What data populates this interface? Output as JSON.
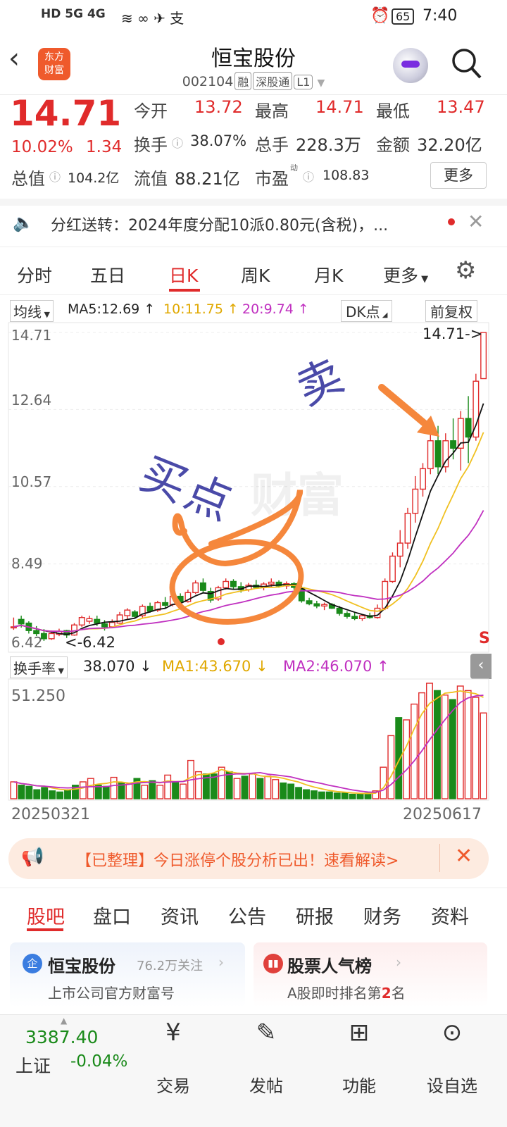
{
  "status_bar": {
    "left_icons": "HD 5G 4G",
    "battery": "65",
    "time": "7:40"
  },
  "header": {
    "title": "恒宝股份",
    "code": "002104",
    "tags": [
      "融",
      "深股通",
      "L1"
    ],
    "logo_text": [
      "东方",
      "财富"
    ]
  },
  "quote": {
    "price": "14.71",
    "change_pct": "10.02%",
    "change_abs": "1.34",
    "open_label": "今开",
    "open": "13.72",
    "high_label": "最高",
    "high": "14.71",
    "low_label": "最低",
    "low": "13.47",
    "turnover_label": "换手",
    "turnover": "38.07%",
    "vol_label": "总手",
    "vol": "228.3万",
    "amount_label": "金额",
    "amount": "32.20亿",
    "mcap_label": "总值",
    "mcap": "104.2亿",
    "float_label": "流值",
    "float": "88.21亿",
    "pe_label": "市盈",
    "pe_sup": "动",
    "pe": "108.83",
    "more_button": "更多"
  },
  "notice": {
    "text": "分红送转：2024年度分配10派0.80元(含税)，..."
  },
  "chart_tabs": [
    "分时",
    "五日",
    "日K",
    "周K",
    "月K",
    "更多"
  ],
  "ma_bar": {
    "selector": "均线",
    "ma5": "MA5:12.69 ↑",
    "ma10": "10:11.75 ↑",
    "ma20": "20:9.74 ↑",
    "dk": "DK点",
    "adjust": "前复权"
  },
  "price_axis": [
    "14.71",
    "12.64",
    "10.57",
    "8.49",
    "6.42"
  ],
  "annotations": {
    "last_price": "14.71->",
    "low_marker": "<-6.42",
    "s_marker": "S",
    "sell": "卖",
    "buy": "买点",
    "watermark": "财富"
  },
  "volume_bar": {
    "selector": "换手率",
    "value": "38.070 ↓",
    "ma1": "MA1:43.670 ↓",
    "ma2": "MA2:46.070 ↑",
    "max_label": "51.250"
  },
  "dates": {
    "start": "20250321",
    "end": "20250617"
  },
  "promo": {
    "text": "【已整理】今日涨停个股分析已出！速看解读>"
  },
  "bottom_tabs": [
    "股吧",
    "盘口",
    "资讯",
    "公告",
    "研报",
    "财务",
    "资料"
  ],
  "cards": {
    "left_title": "恒宝股份",
    "left_follow": "76.2万关注",
    "left_sub": "上市公司官方财富号",
    "right_title": "股票人气榜",
    "right_sub_pre": "A股即时排名第",
    "right_sub_num": "2",
    "right_sub_post": "名"
  },
  "index": {
    "value": "3387.40",
    "name": "上证",
    "change": "-0.04%"
  },
  "bottom_nav": [
    "交易",
    "发帖",
    "功能",
    "设自选"
  ],
  "colors": {
    "up": "#e02b2b",
    "down": "#1a8a1a",
    "orange": "#f5873c",
    "ma10": "#f0c020",
    "ma20": "#c030c0"
  },
  "chart_data": {
    "type": "candlestick",
    "ylim": [
      6.42,
      14.71
    ],
    "candles": [
      [
        6.8,
        7.05,
        6.72,
        6.8
      ],
      [
        7.0,
        7.1,
        6.78,
        6.88
      ],
      [
        6.9,
        6.95,
        6.62,
        6.7
      ],
      [
        6.7,
        6.82,
        6.55,
        6.62
      ],
      [
        6.62,
        6.74,
        6.42,
        6.48
      ],
      [
        6.48,
        6.7,
        6.45,
        6.62
      ],
      [
        6.6,
        6.75,
        6.55,
        6.68
      ],
      [
        6.7,
        6.72,
        6.5,
        6.58
      ],
      [
        6.58,
        6.9,
        6.56,
        6.85
      ],
      [
        6.85,
        7.1,
        6.8,
        7.05
      ],
      [
        6.95,
        7.1,
        6.88,
        7.02
      ],
      [
        7.0,
        7.1,
        6.82,
        6.9
      ],
      [
        6.88,
        6.98,
        6.7,
        6.8
      ],
      [
        6.8,
        7.0,
        6.76,
        6.92
      ],
      [
        6.9,
        7.2,
        6.88,
        7.12
      ],
      [
        7.1,
        7.3,
        7.0,
        7.25
      ],
      [
        7.2,
        7.25,
        7.02,
        7.08
      ],
      [
        7.1,
        7.4,
        7.05,
        7.35
      ],
      [
        7.35,
        7.45,
        7.18,
        7.22
      ],
      [
        7.25,
        7.5,
        7.2,
        7.45
      ],
      [
        7.45,
        7.6,
        7.3,
        7.38
      ],
      [
        7.4,
        7.7,
        7.35,
        7.62
      ],
      [
        7.62,
        7.7,
        7.4,
        7.46
      ],
      [
        7.48,
        7.8,
        7.45,
        7.72
      ],
      [
        7.72,
        8.05,
        7.68,
        7.98
      ],
      [
        7.98,
        8.1,
        7.7,
        7.78
      ],
      [
        7.75,
        7.85,
        7.45,
        7.52
      ],
      [
        7.55,
        7.9,
        7.5,
        7.85
      ],
      [
        7.85,
        8.1,
        7.8,
        8.02
      ],
      [
        8.02,
        8.08,
        7.8,
        7.88
      ],
      [
        7.88,
        8.0,
        7.72,
        7.8
      ],
      [
        7.8,
        7.98,
        7.75,
        7.92
      ],
      [
        7.92,
        8.06,
        7.82,
        7.86
      ],
      [
        7.86,
        8.0,
        7.78,
        7.95
      ],
      [
        7.95,
        8.1,
        7.88,
        8.0
      ],
      [
        8.0,
        8.05,
        7.85,
        7.9
      ],
      [
        7.9,
        8.02,
        7.82,
        7.96
      ],
      [
        7.96,
        8.0,
        7.8,
        7.86
      ],
      [
        7.85,
        7.92,
        7.45,
        7.5
      ],
      [
        7.5,
        7.58,
        7.38,
        7.42
      ],
      [
        7.42,
        7.5,
        7.3,
        7.36
      ],
      [
        7.36,
        7.45,
        7.25,
        7.4
      ],
      [
        7.4,
        7.44,
        7.28,
        7.3
      ],
      [
        7.3,
        7.36,
        7.1,
        7.16
      ],
      [
        7.16,
        7.22,
        7.02,
        7.08
      ],
      [
        7.08,
        7.18,
        6.98,
        7.02
      ],
      [
        7.02,
        7.14,
        6.96,
        7.1
      ],
      [
        7.1,
        7.18,
        7.02,
        7.05
      ],
      [
        7.05,
        7.4,
        7.02,
        7.3
      ],
      [
        7.3,
        8.1,
        7.25,
        8.02
      ],
      [
        8.02,
        8.8,
        7.98,
        8.7
      ],
      [
        8.7,
        9.4,
        8.4,
        9.05
      ],
      [
        9.05,
        10.0,
        8.9,
        9.85
      ],
      [
        9.85,
        10.85,
        9.6,
        10.5
      ],
      [
        10.5,
        11.2,
        10.3,
        11.05
      ],
      [
        11.05,
        12.1,
        10.9,
        11.8
      ],
      [
        11.8,
        12.2,
        10.9,
        11.1
      ],
      [
        11.1,
        12.0,
        10.95,
        11.8
      ],
      [
        11.8,
        12.4,
        11.3,
        11.6
      ],
      [
        11.6,
        12.6,
        11.0,
        12.4
      ],
      [
        12.4,
        13.0,
        11.2,
        11.9
      ],
      [
        11.9,
        13.6,
        11.8,
        13.4
      ],
      [
        13.47,
        14.71,
        13.47,
        14.71
      ]
    ],
    "turnover": [
      [
        7.5,
        0
      ],
      [
        6.0,
        1
      ],
      [
        5.5,
        1
      ],
      [
        4.0,
        1
      ],
      [
        5.0,
        1
      ],
      [
        3.5,
        1
      ],
      [
        3.0,
        1
      ],
      [
        4.0,
        1
      ],
      [
        6.0,
        1
      ],
      [
        7.5,
        0
      ],
      [
        9.0,
        0
      ],
      [
        6.0,
        1
      ],
      [
        5.5,
        1
      ],
      [
        9.5,
        0
      ],
      [
        7.0,
        1
      ],
      [
        6.5,
        0
      ],
      [
        9.0,
        1
      ],
      [
        6.0,
        0
      ],
      [
        8.0,
        1
      ],
      [
        6.0,
        0
      ],
      [
        10.5,
        0
      ],
      [
        7.5,
        1
      ],
      [
        6.5,
        0
      ],
      [
        17.0,
        0
      ],
      [
        12.0,
        0
      ],
      [
        11.0,
        1
      ],
      [
        11.0,
        1
      ],
      [
        14.0,
        0
      ],
      [
        12.0,
        1
      ],
      [
        9.0,
        0
      ],
      [
        10.0,
        1
      ],
      [
        11.0,
        0
      ],
      [
        9.0,
        1
      ],
      [
        10.0,
        0
      ],
      [
        8.5,
        0
      ],
      [
        7.0,
        1
      ],
      [
        6.5,
        1
      ],
      [
        5.0,
        1
      ],
      [
        4.0,
        1
      ],
      [
        3.5,
        1
      ],
      [
        3.0,
        1
      ],
      [
        3.0,
        1
      ],
      [
        2.5,
        1
      ],
      [
        2.5,
        1
      ],
      [
        2.0,
        1
      ],
      [
        2.0,
        1
      ],
      [
        2.5,
        1
      ],
      [
        3.5,
        0
      ],
      [
        14.0,
        0
      ],
      [
        28.0,
        0
      ],
      [
        36.0,
        1
      ],
      [
        35.0,
        0
      ],
      [
        42.0,
        0
      ],
      [
        47.0,
        0
      ],
      [
        51.25,
        0
      ],
      [
        48.0,
        1
      ],
      [
        46.0,
        0
      ],
      [
        44.0,
        1
      ],
      [
        50.0,
        0
      ],
      [
        48.0,
        0
      ],
      [
        45.0,
        0
      ],
      [
        38.07,
        0
      ]
    ]
  }
}
